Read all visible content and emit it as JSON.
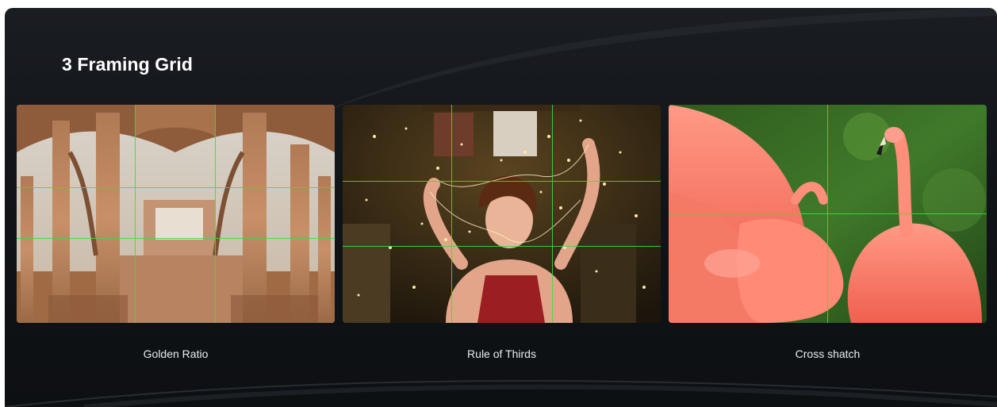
{
  "page": {
    "title": "3 Framing Grid"
  },
  "grids": [
    {
      "caption": "Golden Ratio"
    },
    {
      "caption": "Rule of Thirds"
    },
    {
      "caption": "Cross shatch"
    }
  ],
  "colors": {
    "panel_background": "#111418",
    "grid_line": "#3ddc3d",
    "title_text": "#ffffff",
    "caption_text": "#e9ecef"
  }
}
